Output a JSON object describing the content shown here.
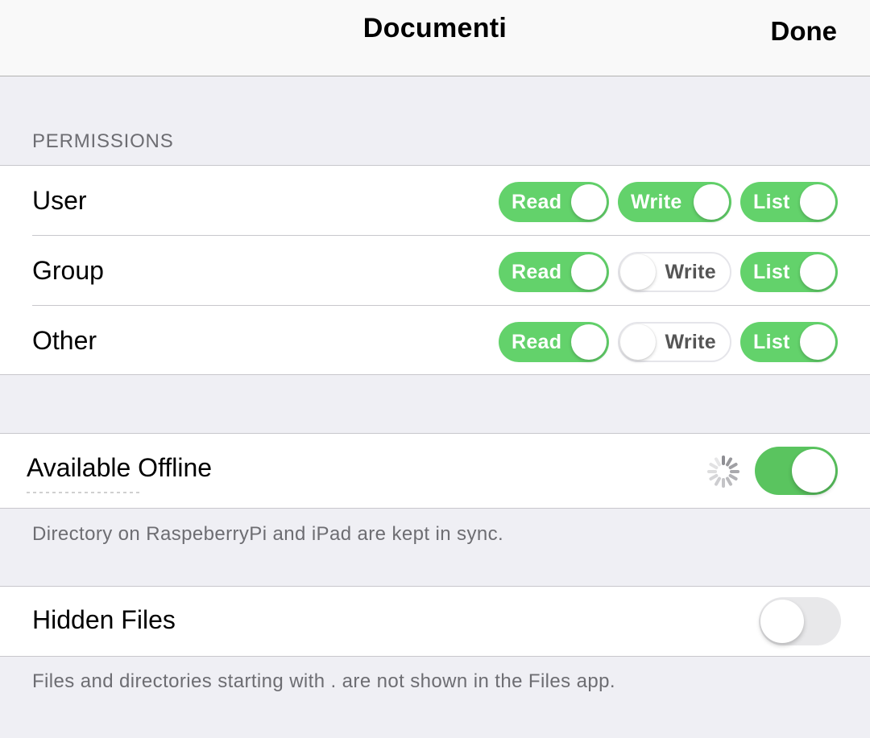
{
  "nav": {
    "title": "Documenti",
    "done_label": "Done"
  },
  "permissions": {
    "header": "PERMISSIONS",
    "rows": [
      {
        "label": "User",
        "read": {
          "label": "Read",
          "on": true
        },
        "write": {
          "label": "Write",
          "on": true
        },
        "list": {
          "label": "List",
          "on": true
        }
      },
      {
        "label": "Group",
        "read": {
          "label": "Read",
          "on": true
        },
        "write": {
          "label": "Write",
          "on": false
        },
        "list": {
          "label": "List",
          "on": true
        }
      },
      {
        "label": "Other",
        "read": {
          "label": "Read",
          "on": true
        },
        "write": {
          "label": "Write",
          "on": false
        },
        "list": {
          "label": "List",
          "on": true
        }
      }
    ]
  },
  "offline": {
    "label": "Available Offline",
    "on": true,
    "syncing": true,
    "footer": "Directory on RaspeberryPi and iPad are kept in sync."
  },
  "hidden_files": {
    "label": "Hidden Files",
    "on": false,
    "footer": "Files and directories starting with . are not shown in the Files app."
  },
  "colors": {
    "toggle_on": "#63d26b",
    "background": "#efeff4",
    "secondary_text": "#6d6d72"
  }
}
